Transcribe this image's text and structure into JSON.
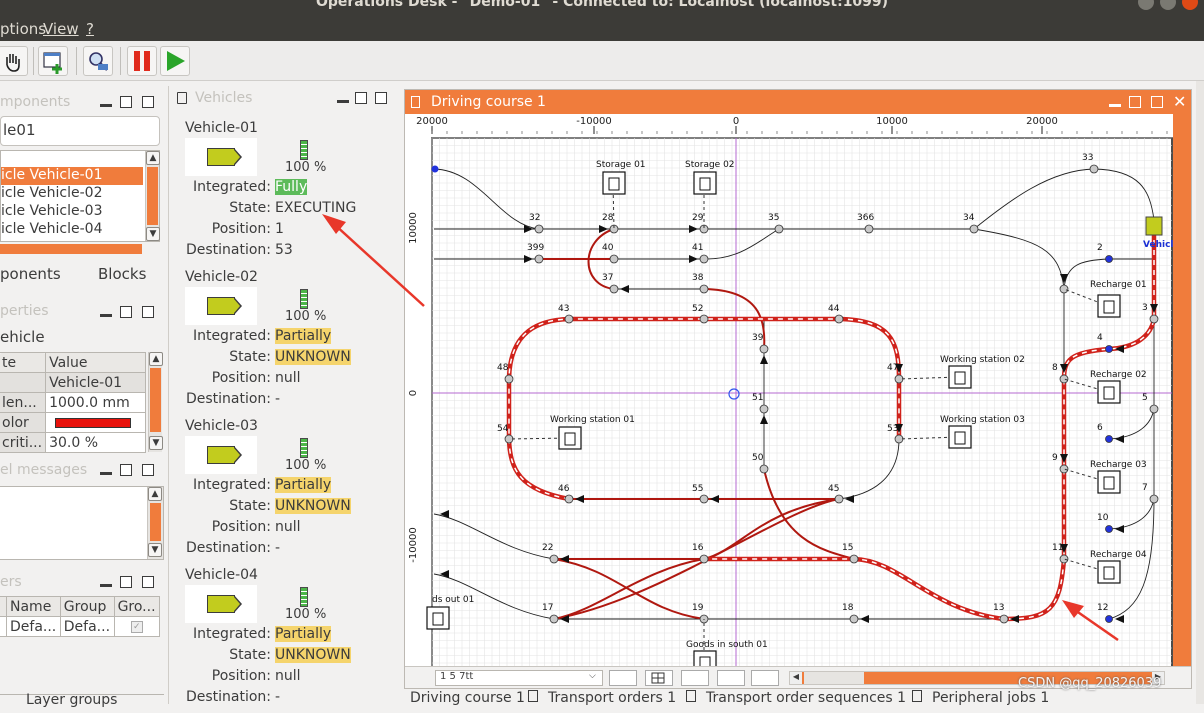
{
  "window": {
    "title": "Operations Desk - \"Demo-01\" - Connected to: Localhost (localhost:1099)"
  },
  "menu": [
    "ptions",
    "View",
    "?"
  ],
  "left": {
    "components_title": "mponents",
    "model_name": "le01",
    "vehicles_list": [
      "icle Vehicle-01",
      "icle Vehicle-02",
      "icle Vehicle-03",
      "icle Vehicle-04"
    ],
    "tabs": [
      "ponents",
      "Blocks"
    ],
    "properties_title": "perties",
    "properties_heading": "ehicle",
    "prop_headers": [
      "te",
      "Value"
    ],
    "props": [
      [
        "",
        "Vehicle-01"
      ],
      [
        " len...",
        "1000.0 mm"
      ],
      [
        "olor",
        ""
      ],
      [
        " criti...",
        "30.0 %"
      ]
    ],
    "messages_title": "el messages",
    "groups_title": "ers",
    "group_headers": [
      "",
      "Name",
      "Group",
      "Gro..."
    ],
    "group_row": [
      "",
      "Defa...",
      "Defa...",
      ""
    ],
    "bottom_tab": "Layer groups",
    "vehicle_color": "#e8120c"
  },
  "vehicles_panel": {
    "title": "Vehicles",
    "labels": {
      "integrated": "Integrated:",
      "state": "State:",
      "position": "Position:",
      "destination": "Destination:"
    },
    "items": [
      {
        "name": "Vehicle-01",
        "battery": "100 %",
        "integrated": "Fully",
        "state": "EXECUTING",
        "position": "1",
        "destination": "53"
      },
      {
        "name": "Vehicle-02",
        "battery": "100 %",
        "integrated": "Partially",
        "state": "UNKNOWN",
        "position": "null",
        "destination": "-"
      },
      {
        "name": "Vehicle-03",
        "battery": "100 %",
        "integrated": "Partially",
        "state": "UNKNOWN",
        "position": "null",
        "destination": "-"
      },
      {
        "name": "Vehicle-04",
        "battery": "100 %",
        "integrated": "Partially",
        "state": "UNKNOWN",
        "position": "null",
        "destination": "-"
      }
    ]
  },
  "course": {
    "title": "Driving course 1",
    "x_ticks": [
      "20000",
      "-10000",
      "0",
      "10000",
      "20000"
    ],
    "y_ticks": [
      "10000",
      "0",
      "-10000"
    ],
    "points": [
      "32",
      "28",
      "29",
      "35",
      "366",
      "34",
      "33",
      "399",
      "40",
      "41",
      "37",
      "38",
      "43",
      "52",
      "44",
      "39",
      "48",
      "47",
      "51",
      "54",
      "53",
      "50",
      "46",
      "55",
      "45",
      "22",
      "16",
      "15",
      "17",
      "19",
      "18",
      "13",
      "2",
      "3",
      "4",
      "5",
      "6",
      "7",
      "8",
      "9",
      "10",
      "11",
      "12",
      "1"
    ],
    "stations": [
      "Storage 01",
      "Storage 02",
      "Recharge 01",
      "Recharge 02",
      "Recharge 03",
      "Recharge 04",
      "Working station 01",
      "Working station 02",
      "Working station 03",
      "Goods in south 01",
      "ds out 01"
    ],
    "vehicle_label": "Vehicl",
    "combo_value": "1 5 7tt",
    "tabs": [
      "Driving course 1",
      "Transport orders 1",
      "Transport order sequences 1",
      "Peripheral jobs 1"
    ]
  },
  "colors": {
    "accent": "#f07c3c",
    "route": "#d0221b",
    "route_dark": "#b01810",
    "integrated_full": "#5dbb5a",
    "integrated_partial": "#f5d46c"
  },
  "watermark": "CSDN @qq_20826039"
}
